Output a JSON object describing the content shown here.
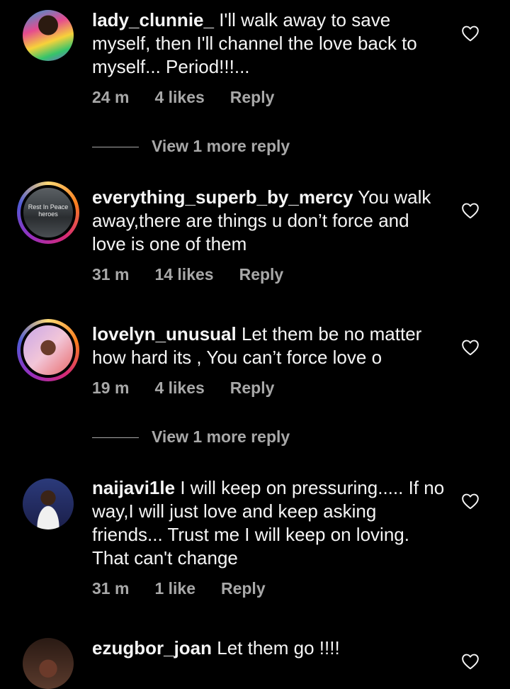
{
  "comments": [
    {
      "username": "lady_clunnie_",
      "text": "I'll walk away to save myself, then I'll channel the love back to myself... Period!!!...",
      "time": "24 m",
      "likes": "4 likes",
      "reply": "Reply",
      "view_more": "View 1 more reply"
    },
    {
      "username": "everything_superb_by_mercy",
      "text": "You walk away,there are things u don’t force and love is one of them",
      "time": "31 m",
      "likes": "14 likes",
      "reply": "Reply",
      "avatar_caption": "Rest In Peace heroes"
    },
    {
      "username": "lovelyn_unusual",
      "text": "Let them be no matter how hard its , You can’t force love o",
      "time": "19 m",
      "likes": "4 likes",
      "reply": "Reply",
      "view_more": "View 1 more reply"
    },
    {
      "username": "naijavi1le",
      "text": "I will keep on pressuring..... If no way,I will just love and keep asking friends... Trust me I will keep on loving. That can't change",
      "time": "31 m",
      "likes": "1 like",
      "reply": "Reply"
    },
    {
      "username": "ezugbor_joan",
      "text": "Let them go !!!!"
    }
  ],
  "colors": {
    "background": "#000000",
    "text": "#f5f5f5",
    "muted": "#a8a8a8"
  },
  "icons": {
    "like": "heart-outline-icon"
  }
}
